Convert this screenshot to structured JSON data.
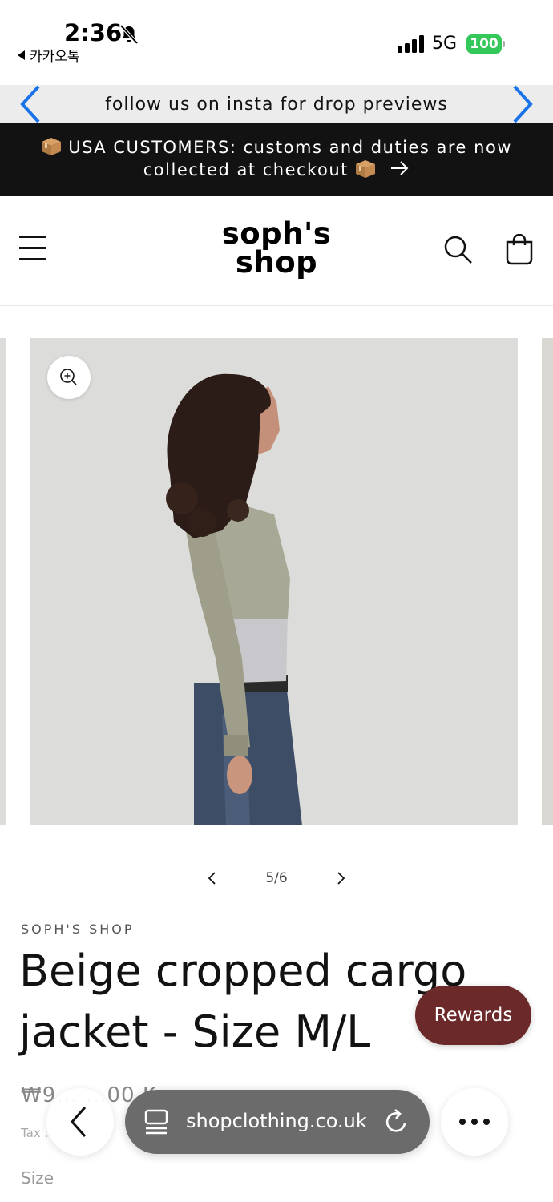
{
  "status_bar": {
    "time": "2:36",
    "back_app": "카카오톡",
    "network": "5G",
    "battery": "100"
  },
  "announcements": {
    "promo": "follow us on insta for drop previews",
    "customs_line1": "USA CUSTOMERS: customs and duties are now",
    "customs_line2": "collected at checkout"
  },
  "header": {
    "logo_line1": "soph's",
    "logo_line2": "shop"
  },
  "gallery": {
    "current": 5,
    "total": 6,
    "counter": "5/6"
  },
  "product": {
    "vendor": "SOPH'S SHOP",
    "title": "Beige cropped cargo jacket - Size M/L",
    "price": "₩9… …00 K…",
    "tax": "Tax …",
    "size_label": "Size"
  },
  "rewards": {
    "label": "Rewards"
  },
  "browser": {
    "url": "shopclothing.co.uk"
  },
  "colors": {
    "rewards_bg": "#6b2929",
    "announcement_bg": "#121212",
    "promo_bg": "#ececec",
    "arrow_blue": "#1a73e8",
    "battery_green": "#34c759"
  },
  "icons": [
    "bell-slash-icon",
    "signal-icon",
    "chevron-left-icon",
    "chevron-right-icon",
    "box-icon",
    "arrow-right-icon",
    "menu-icon",
    "search-icon",
    "cart-icon",
    "zoom-icon",
    "tabs-icon",
    "reload-icon",
    "more-icon"
  ]
}
